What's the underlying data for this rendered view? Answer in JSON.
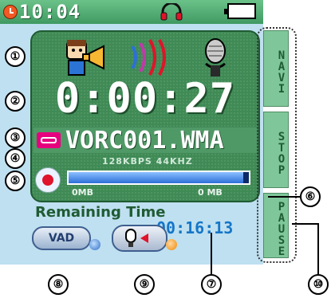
{
  "status_bar": {
    "clock": "10:04"
  },
  "player": {
    "elapsed_time": "0:00:27",
    "filename": "VORC001.WMA",
    "bitrate": "128KBPS 44KHZ",
    "progress_fraction": 0.97,
    "mb_left": "0MB",
    "mb_right": "0   MB"
  },
  "side_buttons": {
    "navi": "NAVI",
    "stop": "STOP",
    "pause": "PAUSE"
  },
  "remaining": {
    "label": "Remaining Time",
    "value": "00:16:13"
  },
  "bottom_buttons": {
    "vad": "VAD"
  },
  "callouts": [
    "①",
    "②",
    "③",
    "④",
    "⑤",
    "⑥",
    "⑦",
    "⑧",
    "⑨",
    "⑩"
  ],
  "colors": {
    "panel": "#3f8a55",
    "screen_bg": "#bfe0f0",
    "progress": "#2d6fd8",
    "remaining_value": "#1576c8",
    "record": "#e0142a"
  },
  "icons": [
    "clock-icon",
    "headphones-icon",
    "battery-icon",
    "speaker-person-icon",
    "sound-waves-icon",
    "microphone-icon",
    "cassette-file-icon",
    "record-icon",
    "mic-button-icon"
  ]
}
